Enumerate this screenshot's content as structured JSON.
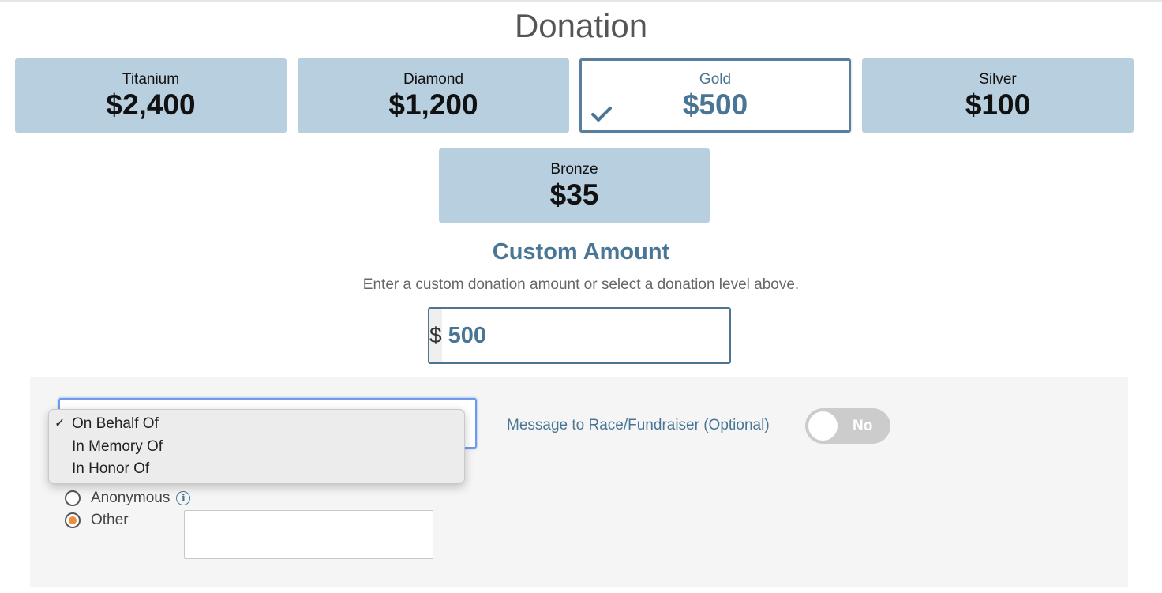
{
  "page": {
    "title": "Donation"
  },
  "levels": [
    {
      "name": "Titanium",
      "amount": "$2,400"
    },
    {
      "name": "Diamond",
      "amount": "$1,200"
    },
    {
      "name": "Gold",
      "amount": "$500",
      "selected": true
    },
    {
      "name": "Silver",
      "amount": "$100"
    },
    {
      "name": "Bronze",
      "amount": "$35"
    }
  ],
  "custom": {
    "title": "Custom Amount",
    "help": "Enter a custom donation amount or select a donation level above.",
    "currency_symbol": "$",
    "value": "500"
  },
  "recognition": {
    "dropdown_options": [
      {
        "label": "On Behalf Of",
        "checked": true
      },
      {
        "label": "In Memory Of",
        "checked": false
      },
      {
        "label": "In Honor Of",
        "checked": false
      }
    ],
    "options": [
      {
        "label": "Anonymous",
        "checked": false,
        "info_icon": "info-icon"
      },
      {
        "label": "Other",
        "checked": true
      }
    ],
    "other_value": ""
  },
  "message": {
    "label": "Message to Race/Fundraiser (Optional)",
    "toggle_state": "No"
  },
  "colors": {
    "level_bg": "#b8cfdf",
    "accent": "#4a7696",
    "radio_checked": "#ee8d3c",
    "toggle_off": "#cccccc"
  }
}
